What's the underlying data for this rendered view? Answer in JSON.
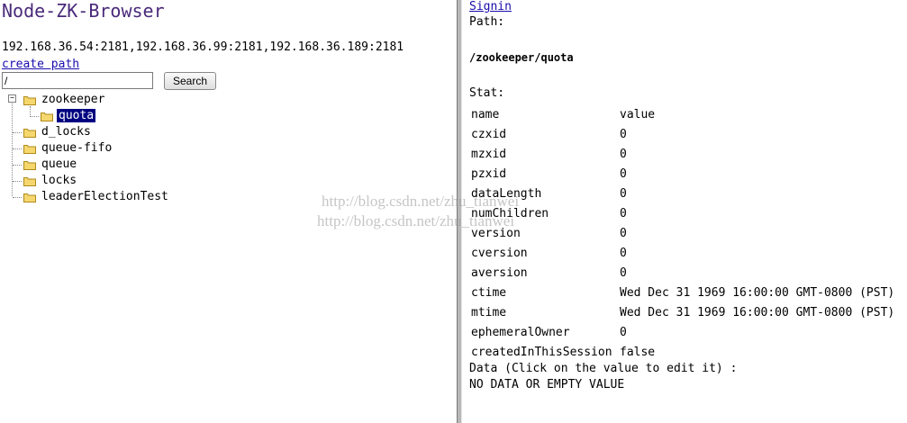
{
  "app": {
    "title": "Node-ZK-Browser",
    "servers": "192.168.36.54:2181,192.168.36.99:2181,192.168.36.189:2181",
    "create_path_label": "create path"
  },
  "search": {
    "value": "/",
    "button_label": "Search"
  },
  "tree": {
    "zookeeper": "zookeeper",
    "quota": "quota",
    "d_locks": "d_locks",
    "queue_fifo": "queue-fifo",
    "queue": "queue",
    "locks": "locks",
    "leaderElectionTest": "leaderElectionTest",
    "selected": "quota",
    "icons": {
      "expander": "minus-box-icon",
      "folder": "folder-icon"
    }
  },
  "detail": {
    "signin_label": "Signin",
    "path_label": "Path:",
    "current_path": "/zookeeper/quota",
    "stat_label": "Stat:",
    "table_headers": [
      "name",
      "value"
    ],
    "stats": [
      {
        "name": "czxid",
        "value": "0"
      },
      {
        "name": "mzxid",
        "value": "0"
      },
      {
        "name": "pzxid",
        "value": "0"
      },
      {
        "name": "dataLength",
        "value": "0"
      },
      {
        "name": "numChildren",
        "value": "0"
      },
      {
        "name": "version",
        "value": "0"
      },
      {
        "name": "cversion",
        "value": "0"
      },
      {
        "name": "aversion",
        "value": "0"
      },
      {
        "name": "ctime",
        "value": "Wed Dec 31 1969 16:00:00 GMT-0800 (PST)"
      },
      {
        "name": "mtime",
        "value": "Wed Dec 31 1969 16:00:00 GMT-0800 (PST)"
      },
      {
        "name": "ephemeralOwner",
        "value": "0"
      },
      {
        "name": "createdInThisSession",
        "value": "false"
      }
    ],
    "data_label": "Data (Click on the value to edit it) :",
    "data_value": "NO DATA OR EMPTY VALUE"
  },
  "watermark": {
    "line1": "http://blog.csdn.net/zhu_tianwei",
    "line2": "http://blog.csdn.net/zhu_tianwei"
  },
  "colors": {
    "title": "#4a2a7a",
    "link": "#1a0dab",
    "selection": "#000080",
    "folder": "#f5d76e"
  }
}
